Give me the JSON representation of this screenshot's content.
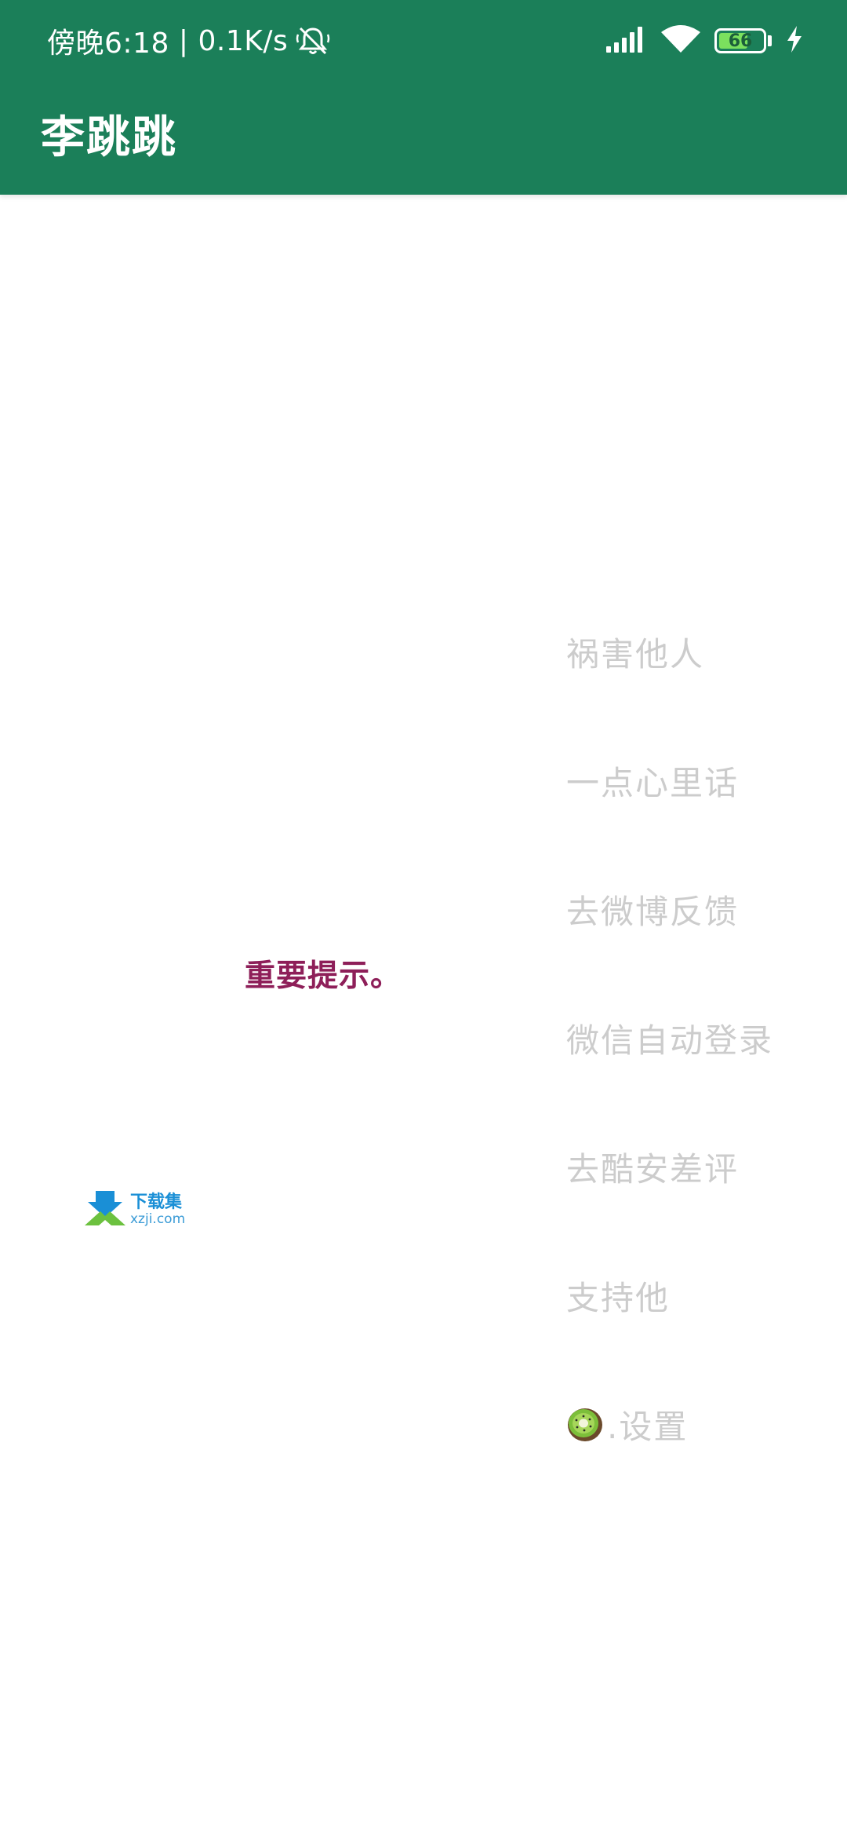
{
  "status_bar": {
    "time": "傍晚6:18",
    "separator": "|",
    "net_speed": "0.1K/s",
    "icons": [
      "mute-bell-icon",
      "signal-icon",
      "wifi-icon",
      "battery-icon",
      "charging-bolt-icon"
    ],
    "battery_level": "66",
    "battery_fraction": 0.66
  },
  "app_bar": {
    "title": "李跳跳",
    "color": "#1b7f59"
  },
  "main": {
    "notice": "重要提示。",
    "notice_color": "#8e1f59"
  },
  "menu": {
    "text_color": "#cccccc",
    "items": [
      {
        "label": "祸害他人"
      },
      {
        "label": "一点心里话"
      },
      {
        "label": "去微博反馈"
      },
      {
        "label": "微信自动登录"
      },
      {
        "label": "去酷安差评"
      },
      {
        "label": "支持他"
      },
      {
        "icon": "kiwi-icon",
        "label": ".设置"
      }
    ]
  },
  "watermark": {
    "line1": "下载集",
    "line2": "xzji.com"
  }
}
